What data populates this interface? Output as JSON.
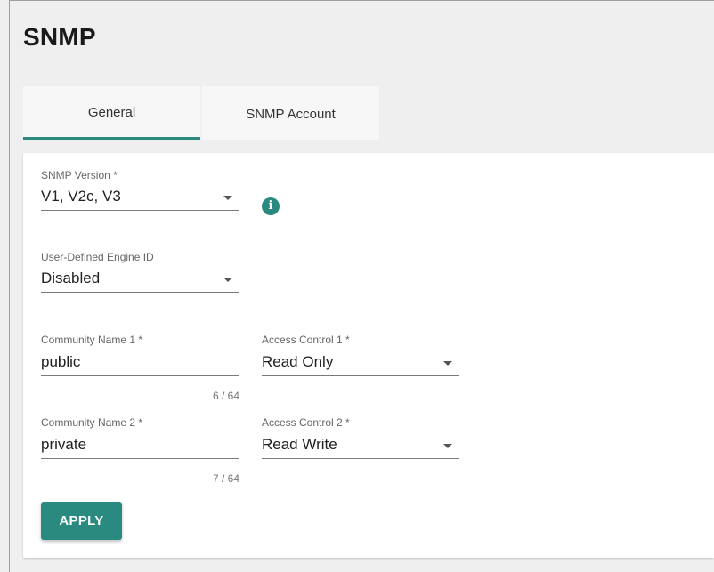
{
  "page": {
    "title": "SNMP"
  },
  "tabs": [
    {
      "label": "General",
      "active": true
    },
    {
      "label": "SNMP Account",
      "active": false
    }
  ],
  "form": {
    "snmp_version": {
      "label": "SNMP Version *",
      "value": "V1, V2c, V3",
      "info_icon": "info-icon"
    },
    "engine_id": {
      "label": "User-Defined Engine ID",
      "value": "Disabled"
    },
    "community1": {
      "label": "Community Name 1 *",
      "value": "public",
      "counter": "6 / 64"
    },
    "access1": {
      "label": "Access Control 1 *",
      "value": "Read Only"
    },
    "community2": {
      "label": "Community Name 2 *",
      "value": "private",
      "counter": "7 / 64"
    },
    "access2": {
      "label": "Access Control 2 *",
      "value": "Read Write"
    }
  },
  "actions": {
    "apply_label": "APPLY"
  },
  "colors": {
    "accent": "#2a8a80",
    "background": "#efefef",
    "card": "#ffffff"
  }
}
